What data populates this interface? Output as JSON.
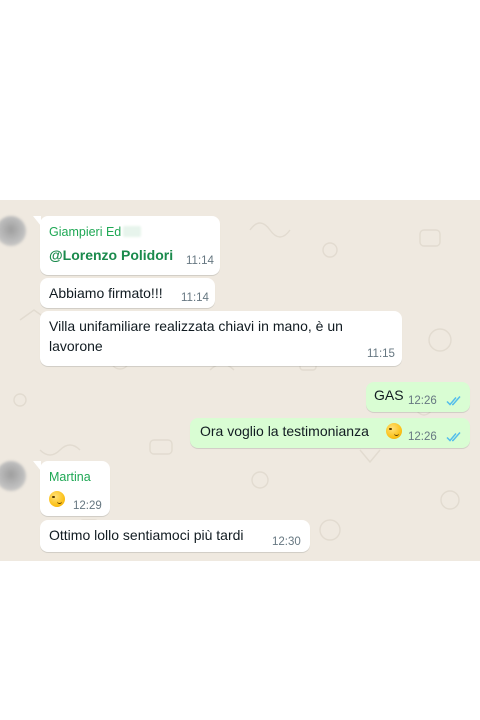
{
  "messages": [
    {
      "sender": "Giampieri Ed",
      "mention": "@Lorenzo Polidori",
      "time": "11:14"
    },
    {
      "text": "Abbiamo firmato!!!",
      "time": "11:14"
    },
    {
      "text_line1": "Villa unifamiliare realizzata chiavi in mano, è un",
      "text_line2": "lavorone",
      "time": "11:15"
    },
    {
      "text": "GAS",
      "time": "12:26"
    },
    {
      "text": "Ora voglio la testimonianza",
      "time": "12:26"
    },
    {
      "sender": "Martina",
      "time": "12:29"
    },
    {
      "text": "Ottimo lollo sentiamoci più tardi",
      "time": "12:30"
    }
  ],
  "colors": {
    "chat_background": "#efe9e0",
    "incoming_bubble": "#ffffff",
    "outgoing_bubble": "#d9fdd3",
    "sender_name": "#1fa855",
    "read_ticks": "#53bdeb"
  },
  "icons": [
    "avatar",
    "double-check-icon",
    "emoji-face-icon"
  ]
}
